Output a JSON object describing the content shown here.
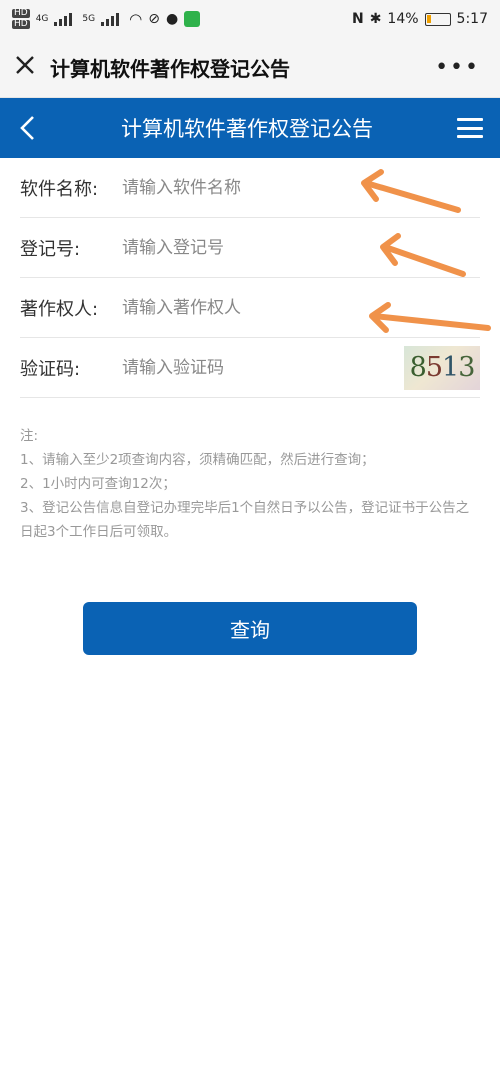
{
  "status_bar": {
    "hd_top": "HD",
    "hd_bottom": "HD",
    "network1": "4G",
    "network2": "5G",
    "battery": "14%",
    "time": "5:17"
  },
  "wechat_bar": {
    "close_icon": "close-icon",
    "title": "计算机软件著作权登记公告",
    "more": "•••"
  },
  "app_header": {
    "title": "计算机软件著作权登记公告",
    "accent": "#0a62b4"
  },
  "form": {
    "fields": [
      {
        "label": "软件名称:",
        "placeholder": "请输入软件名称",
        "value": ""
      },
      {
        "label": "登记号:",
        "placeholder": "请输入登记号",
        "value": ""
      },
      {
        "label": "著作权人:",
        "placeholder": "请输入著作权人",
        "value": ""
      },
      {
        "label": "验证码:",
        "placeholder": "请输入验证码",
        "value": ""
      }
    ],
    "captcha": [
      "8",
      "5",
      "1",
      "3"
    ]
  },
  "notes": {
    "title": "注:",
    "items": [
      "1、请输入至少2项查询内容，须精确匹配，然后进行查询；",
      "2、1小时内可查询12次；",
      "3、登记公告信息自登记办理完毕后1个自然日予以公告，登记证书于公告之日起3个工作日后可领取。"
    ]
  },
  "submit_label": "查询",
  "annotation_color": "#f0924a"
}
